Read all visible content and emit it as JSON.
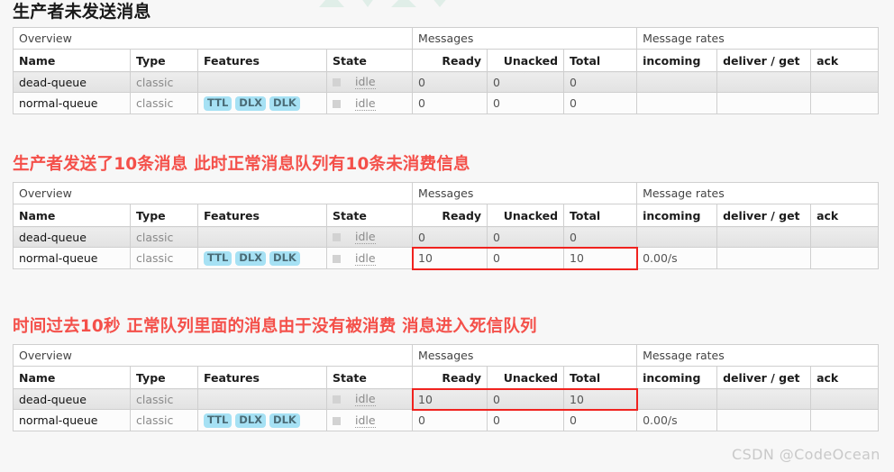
{
  "watermarks": {
    "bottom_right": "CSDN @CodeOcean",
    "top_shape_name": "csdn-logo-watermark"
  },
  "columns": {
    "groups": {
      "overview": "Overview",
      "messages": "Messages",
      "message_rates": "Message rates"
    },
    "headers": {
      "name": "Name",
      "type": "Type",
      "features": "Features",
      "state": "State",
      "ready": "Ready",
      "unacked": "Unacked",
      "total": "Total",
      "incoming": "incoming",
      "deliver_get": "deliver / get",
      "ack": "ack"
    }
  },
  "colors": {
    "heading_red": "#f4504a",
    "heading_dark": "#1a1a1a",
    "badge_bg": "#a6e1f4",
    "badge_text": "#4a6b76",
    "highlight_border": "#f0231f",
    "row_odd_bg": "#e7e7e7",
    "row_even_bg": "#fcfcfc"
  },
  "sections": [
    {
      "id": "no-messages-sent",
      "heading": "生产者未发送消息",
      "heading_style": "dark",
      "rows": [
        {
          "name": "dead-queue",
          "type": "classic",
          "features": [],
          "state": "idle",
          "ready": "0",
          "unacked": "0",
          "total": "0",
          "incoming": "",
          "deliver_get": "",
          "ack": ""
        },
        {
          "name": "normal-queue",
          "type": "classic",
          "features": [
            "TTL",
            "DLX",
            "DLK"
          ],
          "state": "idle",
          "ready": "0",
          "unacked": "0",
          "total": "0",
          "incoming": "",
          "deliver_get": "",
          "ack": ""
        }
      ],
      "highlight": null
    },
    {
      "id": "ten-messages-sent",
      "heading": "生产者发送了10条消息 此时正常消息队列有10条未消费信息",
      "heading_style": "red",
      "rows": [
        {
          "name": "dead-queue",
          "type": "classic",
          "features": [],
          "state": "idle",
          "ready": "0",
          "unacked": "0",
          "total": "0",
          "incoming": "",
          "deliver_get": "",
          "ack": ""
        },
        {
          "name": "normal-queue",
          "type": "classic",
          "features": [
            "TTL",
            "DLX",
            "DLK"
          ],
          "state": "idle",
          "ready": "10",
          "unacked": "0",
          "total": "10",
          "incoming": "0.00/s",
          "deliver_get": "",
          "ack": ""
        }
      ],
      "highlight": {
        "row": 1,
        "from": "ready",
        "to": "total"
      }
    },
    {
      "id": "after-ten-seconds",
      "heading": "时间过去10秒  正常队列里面的消息由于没有被消费 消息进入死信队列",
      "heading_style": "red",
      "rows": [
        {
          "name": "dead-queue",
          "type": "classic",
          "features": [],
          "state": "idle",
          "ready": "10",
          "unacked": "0",
          "total": "10",
          "incoming": "",
          "deliver_get": "",
          "ack": ""
        },
        {
          "name": "normal-queue",
          "type": "classic",
          "features": [
            "TTL",
            "DLX",
            "DLK"
          ],
          "state": "idle",
          "ready": "0",
          "unacked": "0",
          "total": "0",
          "incoming": "0.00/s",
          "deliver_get": "",
          "ack": ""
        }
      ],
      "highlight": {
        "row": 0,
        "from": "ready",
        "to": "total"
      }
    }
  ]
}
